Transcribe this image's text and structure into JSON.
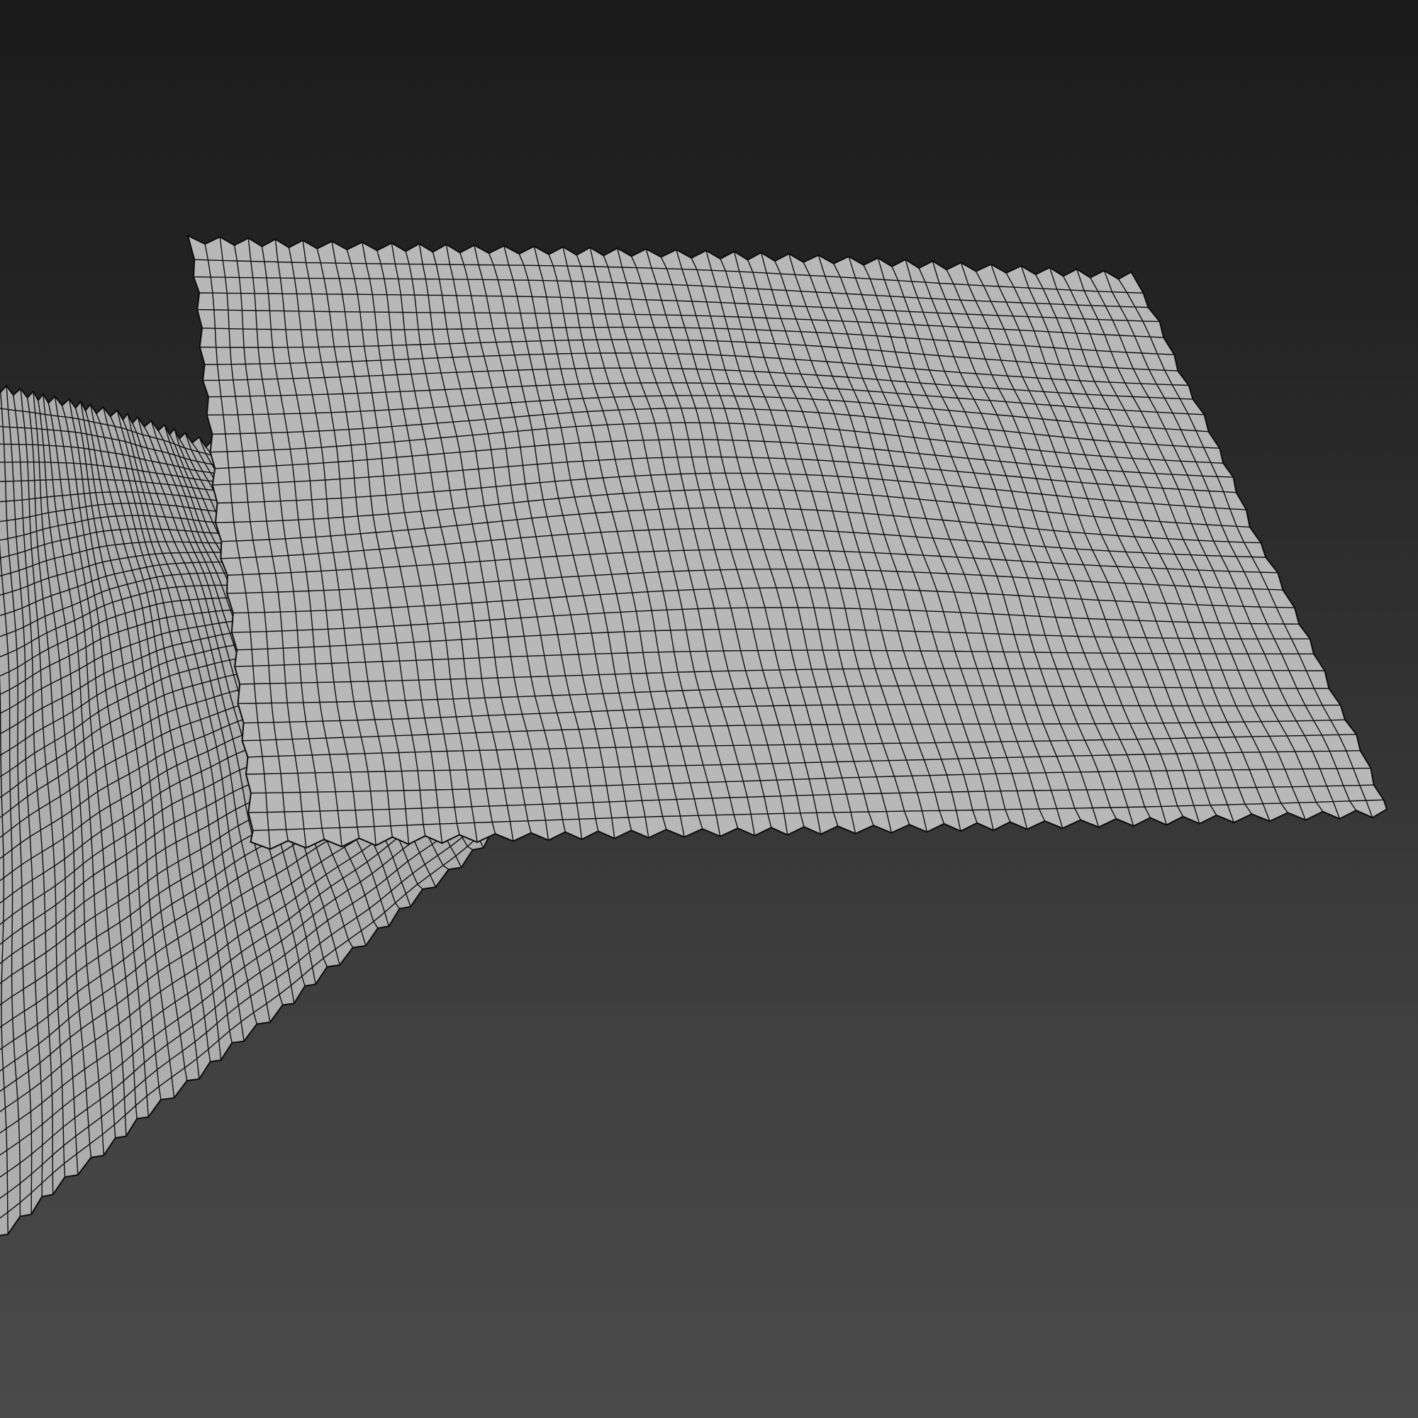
{
  "viewport": {
    "mode": "wireframe-on-shaded",
    "background_top": "#1b1b1b",
    "background_bottom": "#4a4a4a"
  },
  "objects": [
    {
      "name": "cloth-pillow-mesh-front",
      "type": "quad-mesh",
      "shade_color": "#b8b8b8",
      "wire_color": "#0d0d0d",
      "grid_columns": 66,
      "grid_rows": 34
    },
    {
      "name": "cloth-pillow-mesh-back",
      "type": "quad-mesh",
      "shade_color": "#aeaeae",
      "wire_color": "#0d0d0d",
      "grid_columns": 44,
      "grid_rows": 42
    }
  ]
}
